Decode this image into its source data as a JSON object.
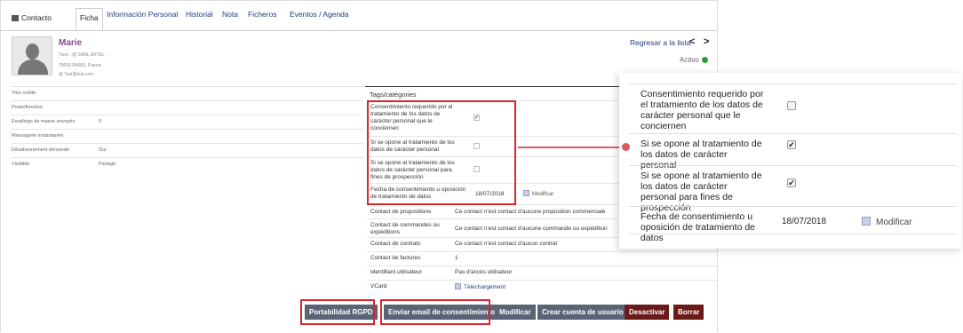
{
  "tabs": {
    "contact_label": "Contacto",
    "items": [
      "Ficha",
      "Información Personal",
      "Historial",
      "Nota",
      "Ficheros",
      "Eventos / Agenda"
    ]
  },
  "header": {
    "name": "Marie",
    "line1": "Tiers : @ SARL ERTEL",
    "line2": "75000 PARIS, France",
    "line3": "@ Test@test.com",
    "back_to_list": "Regresar a la lista",
    "prev": "<",
    "next": ">",
    "status": "Activo"
  },
  "left_fields": [
    {
      "label": "Titre civilité",
      "value": ""
    },
    {
      "label": "Poste/fonction",
      "value": ""
    },
    {
      "label": "Emailings de masse envoyés",
      "value": "0"
    },
    {
      "label": "Messagerie instantanée",
      "value": ""
    },
    {
      "label": "Désabonnement demandé",
      "value": "Oui"
    },
    {
      "label": "Visibilité",
      "value": "Partagé"
    }
  ],
  "right": {
    "tags_label": "Tags/catégories",
    "consent_required": "Consentimiento requerido por el tratamiento de los datos de carácter personal que le conciernen",
    "oppose_processing": "Si se opone al tratamiento de los datos de carácter personal",
    "oppose_prospecting": "Si se opone al tratamiento de los datos de carácter personal para fines de prospección",
    "consent_date_label": "Fecha de consentimiento u oposición de tratamiento de datos",
    "consent_date": "18/07/2018",
    "modify": "Modificar",
    "check_mark": "✔",
    "rows": [
      {
        "label": "Contact de propositions",
        "value": "Ce contact n'est contact d'aucune proposition commerciale"
      },
      {
        "label": "Contact de commandes ou expéditions",
        "value": "Ce contact n'est contact d'aucune commande ou expédition"
      },
      {
        "label": "Contact de contrats",
        "value": "Ce contact n'est contact d'aucun contrat"
      },
      {
        "label": "Contact de factures",
        "value": "1"
      },
      {
        "label": "Identifiant utilisateur",
        "value": "Pas d'accès utilisateur"
      },
      {
        "label": "VCard",
        "value": "Téléchargement"
      }
    ]
  },
  "buttons": {
    "gdpr": "Portabilidad RGPD",
    "send_consent": "Enviar email de consentimiento",
    "modify": "Modificar",
    "create_user": "Crear cuenta de usuario",
    "deactivate": "Desactivar",
    "delete": "Borrar"
  },
  "colors": {
    "highlight": "#d9262e",
    "link": "#263c7b",
    "name": "#8b4a8c",
    "button": "#5b6476",
    "button_danger": "#6b1a1a",
    "active_dot": "#2a9d3a"
  }
}
